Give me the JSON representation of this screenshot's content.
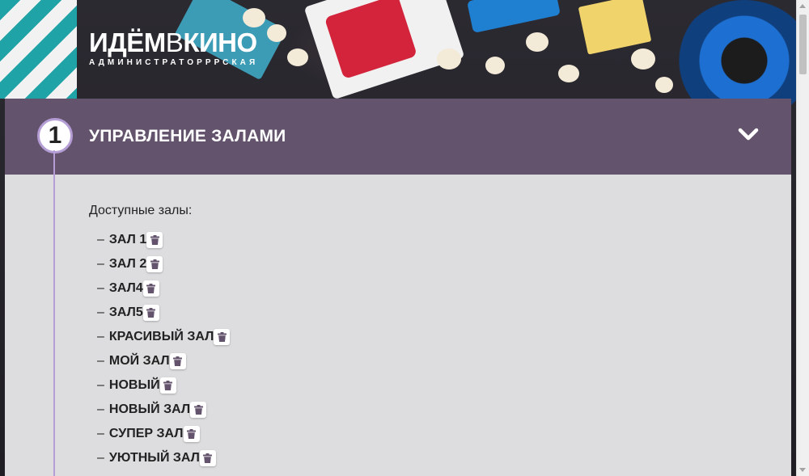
{
  "logo": {
    "part1": "ИДЁМ",
    "part2": "В",
    "part3": "КИНО",
    "subtitle": "АДМИНИСТРАТОРРРСКАЯ"
  },
  "section": {
    "step_number": "1",
    "title": "УПРАВЛЕНИЕ ЗАЛАМИ",
    "toggle_icon": "chevron-down-icon",
    "available_label": "Доступные залы:",
    "dash": "–",
    "halls": [
      {
        "name": "ЗАЛ 1"
      },
      {
        "name": "ЗАЛ 2"
      },
      {
        "name": "ЗАЛ4"
      },
      {
        "name": "ЗАЛ5"
      },
      {
        "name": "КРАСИВЫЙ ЗАЛ"
      },
      {
        "name": "МОЙ ЗАЛ"
      },
      {
        "name": "НОВЫЙ"
      },
      {
        "name": "НОВЫЙ ЗАЛ"
      },
      {
        "name": "СУПЕР ЗАЛ"
      },
      {
        "name": "УЮТНЫЙ ЗАЛ"
      }
    ],
    "delete_icon": "trash-icon"
  },
  "colors": {
    "header_bg": "#63536c",
    "accent": "#b59ed6",
    "trash_icon": "#63536c"
  }
}
